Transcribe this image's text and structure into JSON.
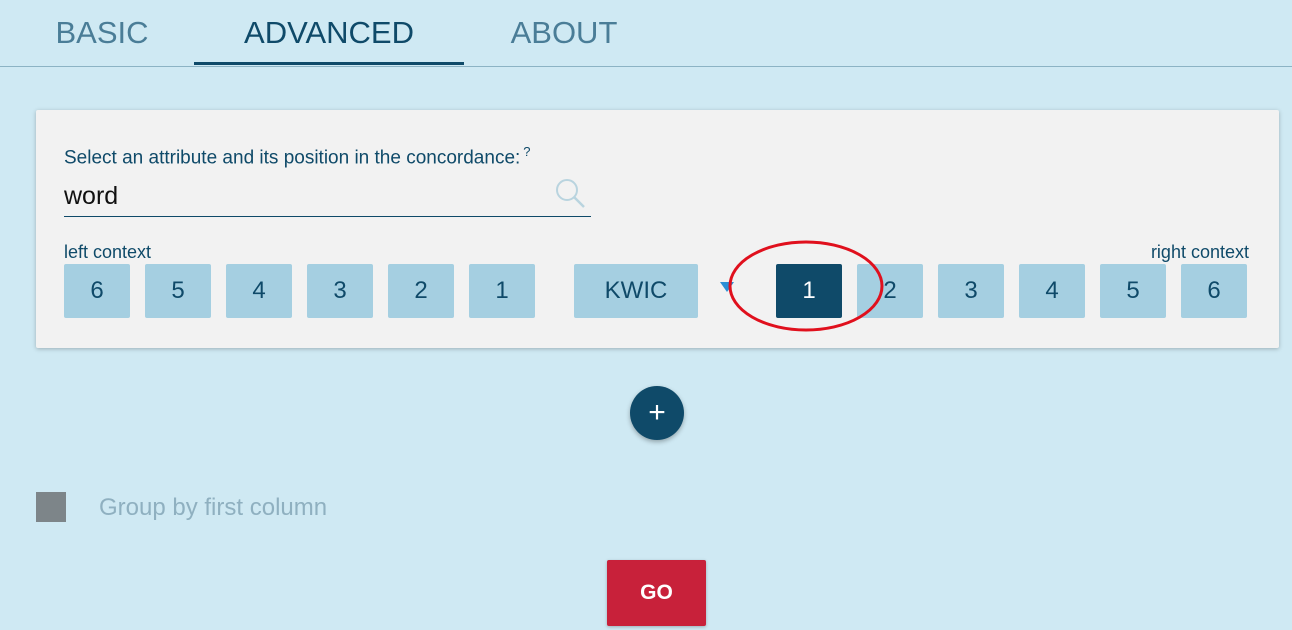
{
  "tabs": [
    {
      "label": "BASIC"
    },
    {
      "label": "ADVANCED"
    },
    {
      "label": "ABOUT"
    }
  ],
  "card": {
    "prompt": "Select an attribute and its position in the concordance:",
    "help_marker": "?",
    "attribute_value": "word",
    "left_context_label": "left context",
    "right_context_label": "right context",
    "left_positions": [
      "6",
      "5",
      "4",
      "3",
      "2",
      "1"
    ],
    "kwic_label": "KWIC",
    "right_positions": [
      "1",
      "2",
      "3",
      "4",
      "5",
      "6"
    ],
    "selected_right_position": "1"
  },
  "add_button": {
    "label": "+"
  },
  "group_option": {
    "label": "Group by first column",
    "checked": false
  },
  "go_button": {
    "label": "GO"
  },
  "colors": {
    "accent": "#0f4a69",
    "button_bg": "#a5cfe1",
    "go": "#c8213a",
    "annotation": "#e0101d"
  }
}
